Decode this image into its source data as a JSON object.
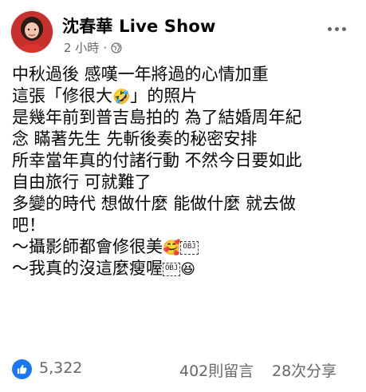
{
  "post": {
    "author": "沈春華 Live Show",
    "time": "2 小時",
    "separator": "·",
    "privacy_icon": "globe-icon",
    "body_lines": [
      {
        "text": "中秋過後 感嘆一年將過的心情加重"
      },
      {
        "text": "這張「修很大",
        "emoji": "🤣",
        "after": "」的照片"
      },
      {
        "text": "是幾年前到普吉島拍的 為了結婚周年紀"
      },
      {
        "text": "念 瞞著先生 先斬後奏的秘密安排"
      },
      {
        "text": "所幸當年真的付諸行動 不然今日要如此"
      },
      {
        "text": "自由旅行 可就難了"
      },
      {
        "text": "多變的時代 想做什麼 能做什麼 就去做"
      },
      {
        "text": "吧！"
      },
      {
        "text": "～攝影師都會修很美",
        "emoji": "🥰",
        "obj": "OBJ"
      },
      {
        "text": "～我真的沒這麼瘦喔",
        "obj": "OBJ",
        "emoji": "😆"
      }
    ]
  },
  "footer": {
    "like_count": "5,322",
    "comments": "402則留言",
    "shares": "28次分享"
  },
  "colors": {
    "text": "#050505",
    "secondary": "#65676b",
    "like_blue": "#1877f2"
  }
}
